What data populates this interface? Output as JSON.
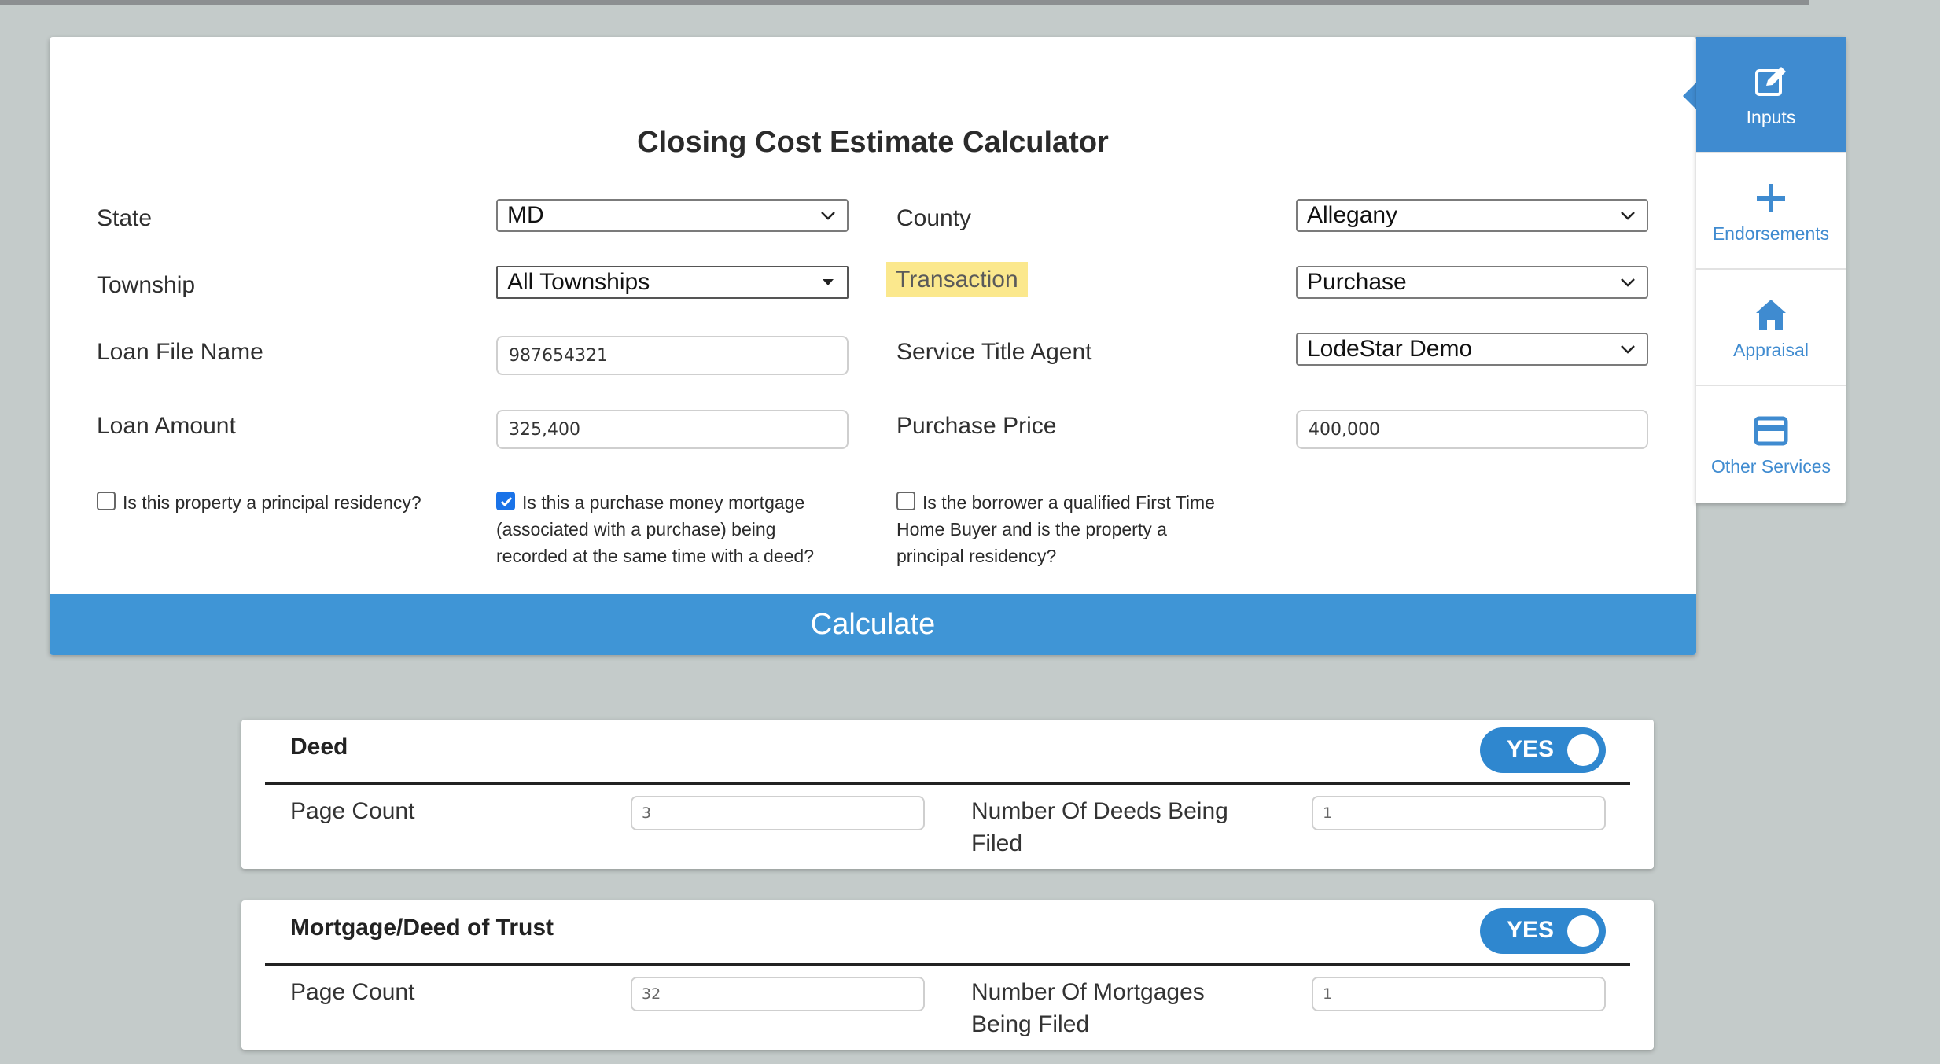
{
  "title": "Closing Cost Estimate Calculator",
  "form": {
    "state_label": "State",
    "state_value": "MD",
    "county_label": "County",
    "county_value": "Allegany",
    "township_label": "Township",
    "township_value": "All Townships",
    "transaction_label": "Transaction",
    "transaction_value": "Purchase",
    "loan_file_label": "Loan File Name",
    "loan_file_value": "987654321",
    "service_agent_label": "Service Title Agent",
    "service_agent_value": "LodeStar Demo",
    "loan_amount_label": "Loan Amount",
    "loan_amount_value": "325,400",
    "purchase_price_label": "Purchase Price",
    "purchase_price_value": "400,000"
  },
  "checkboxes": [
    {
      "text": "Is this property a principal residency?",
      "checked": false
    },
    {
      "text": "Is this a purchase money mortgage (associated with a purchase) being recorded at the same time with a deed?",
      "checked": true
    },
    {
      "text": "Is the borrower a qualified First Time Home Buyer and is the property a principal residency?",
      "checked": false
    }
  ],
  "checkbox_lines": {
    "c1": [
      "Is this property a principal residency?"
    ],
    "c2": [
      "Is this a purchase money mortgage",
      "(associated with a purchase) being",
      "recorded at the same time with a deed?"
    ],
    "c3": [
      "Is the borrower a qualified First Time",
      "Home Buyer and is the property a",
      "principal residency?"
    ]
  },
  "calculate_label": "Calculate",
  "sidebar": {
    "items": [
      {
        "label": "Inputs",
        "icon": "edit-icon",
        "active": true
      },
      {
        "label": "Endorsements",
        "icon": "plus-icon",
        "active": false
      },
      {
        "label": "Appraisal",
        "icon": "home-icon",
        "active": false
      },
      {
        "label": "Other Services",
        "icon": "card-icon",
        "active": false
      }
    ]
  },
  "panels": [
    {
      "title": "Deed",
      "toggle": "YES",
      "page_count_label": "Page Count",
      "page_count_value": "3",
      "number_label_lines": [
        "Number Of Deeds Being",
        "Filed"
      ],
      "number_value": "1"
    },
    {
      "title": "Mortgage/Deed of Trust",
      "toggle": "YES",
      "page_count_label": "Page Count",
      "page_count_value": "32",
      "number_label_lines": [
        "Number Of Mortgages",
        "Being Filed"
      ],
      "number_value": "1"
    }
  ],
  "colors": {
    "accent": "#3f95d6",
    "highlight": "#fbe88d",
    "background": "#c4cbca"
  }
}
